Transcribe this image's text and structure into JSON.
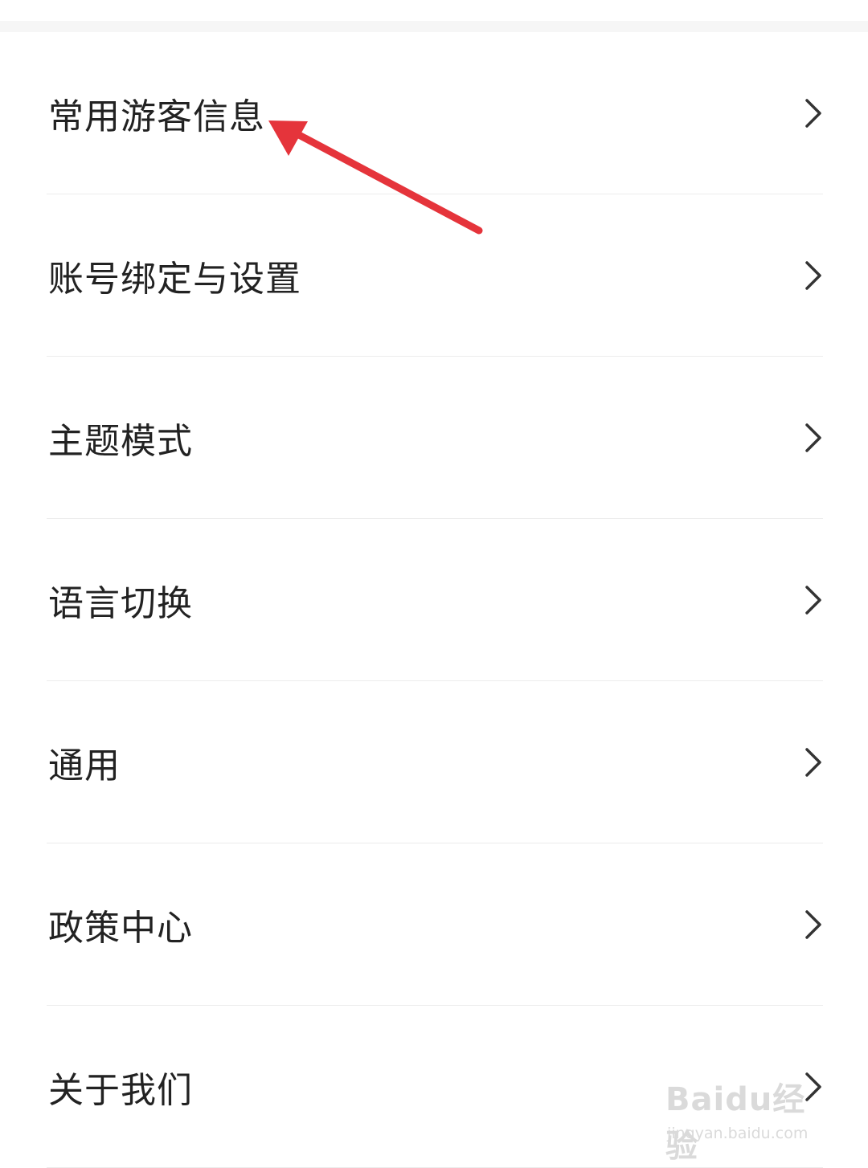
{
  "settings": {
    "items": [
      {
        "label": "常用游客信息"
      },
      {
        "label": "账号绑定与设置"
      },
      {
        "label": "主题模式"
      },
      {
        "label": "语言切换"
      },
      {
        "label": "通用"
      },
      {
        "label": "政策中心"
      },
      {
        "label": "关于我们"
      }
    ]
  },
  "icons": {
    "row_arrow": "chevron-right-icon",
    "annotation": "red-arrow-icon"
  },
  "colors": {
    "text": "#222222",
    "chevron": "#333333",
    "divider": "#ececec",
    "annotation": "#e5343b"
  },
  "watermark": {
    "logo": "Baidu经验",
    "url": "jingyan.baidu.com"
  }
}
